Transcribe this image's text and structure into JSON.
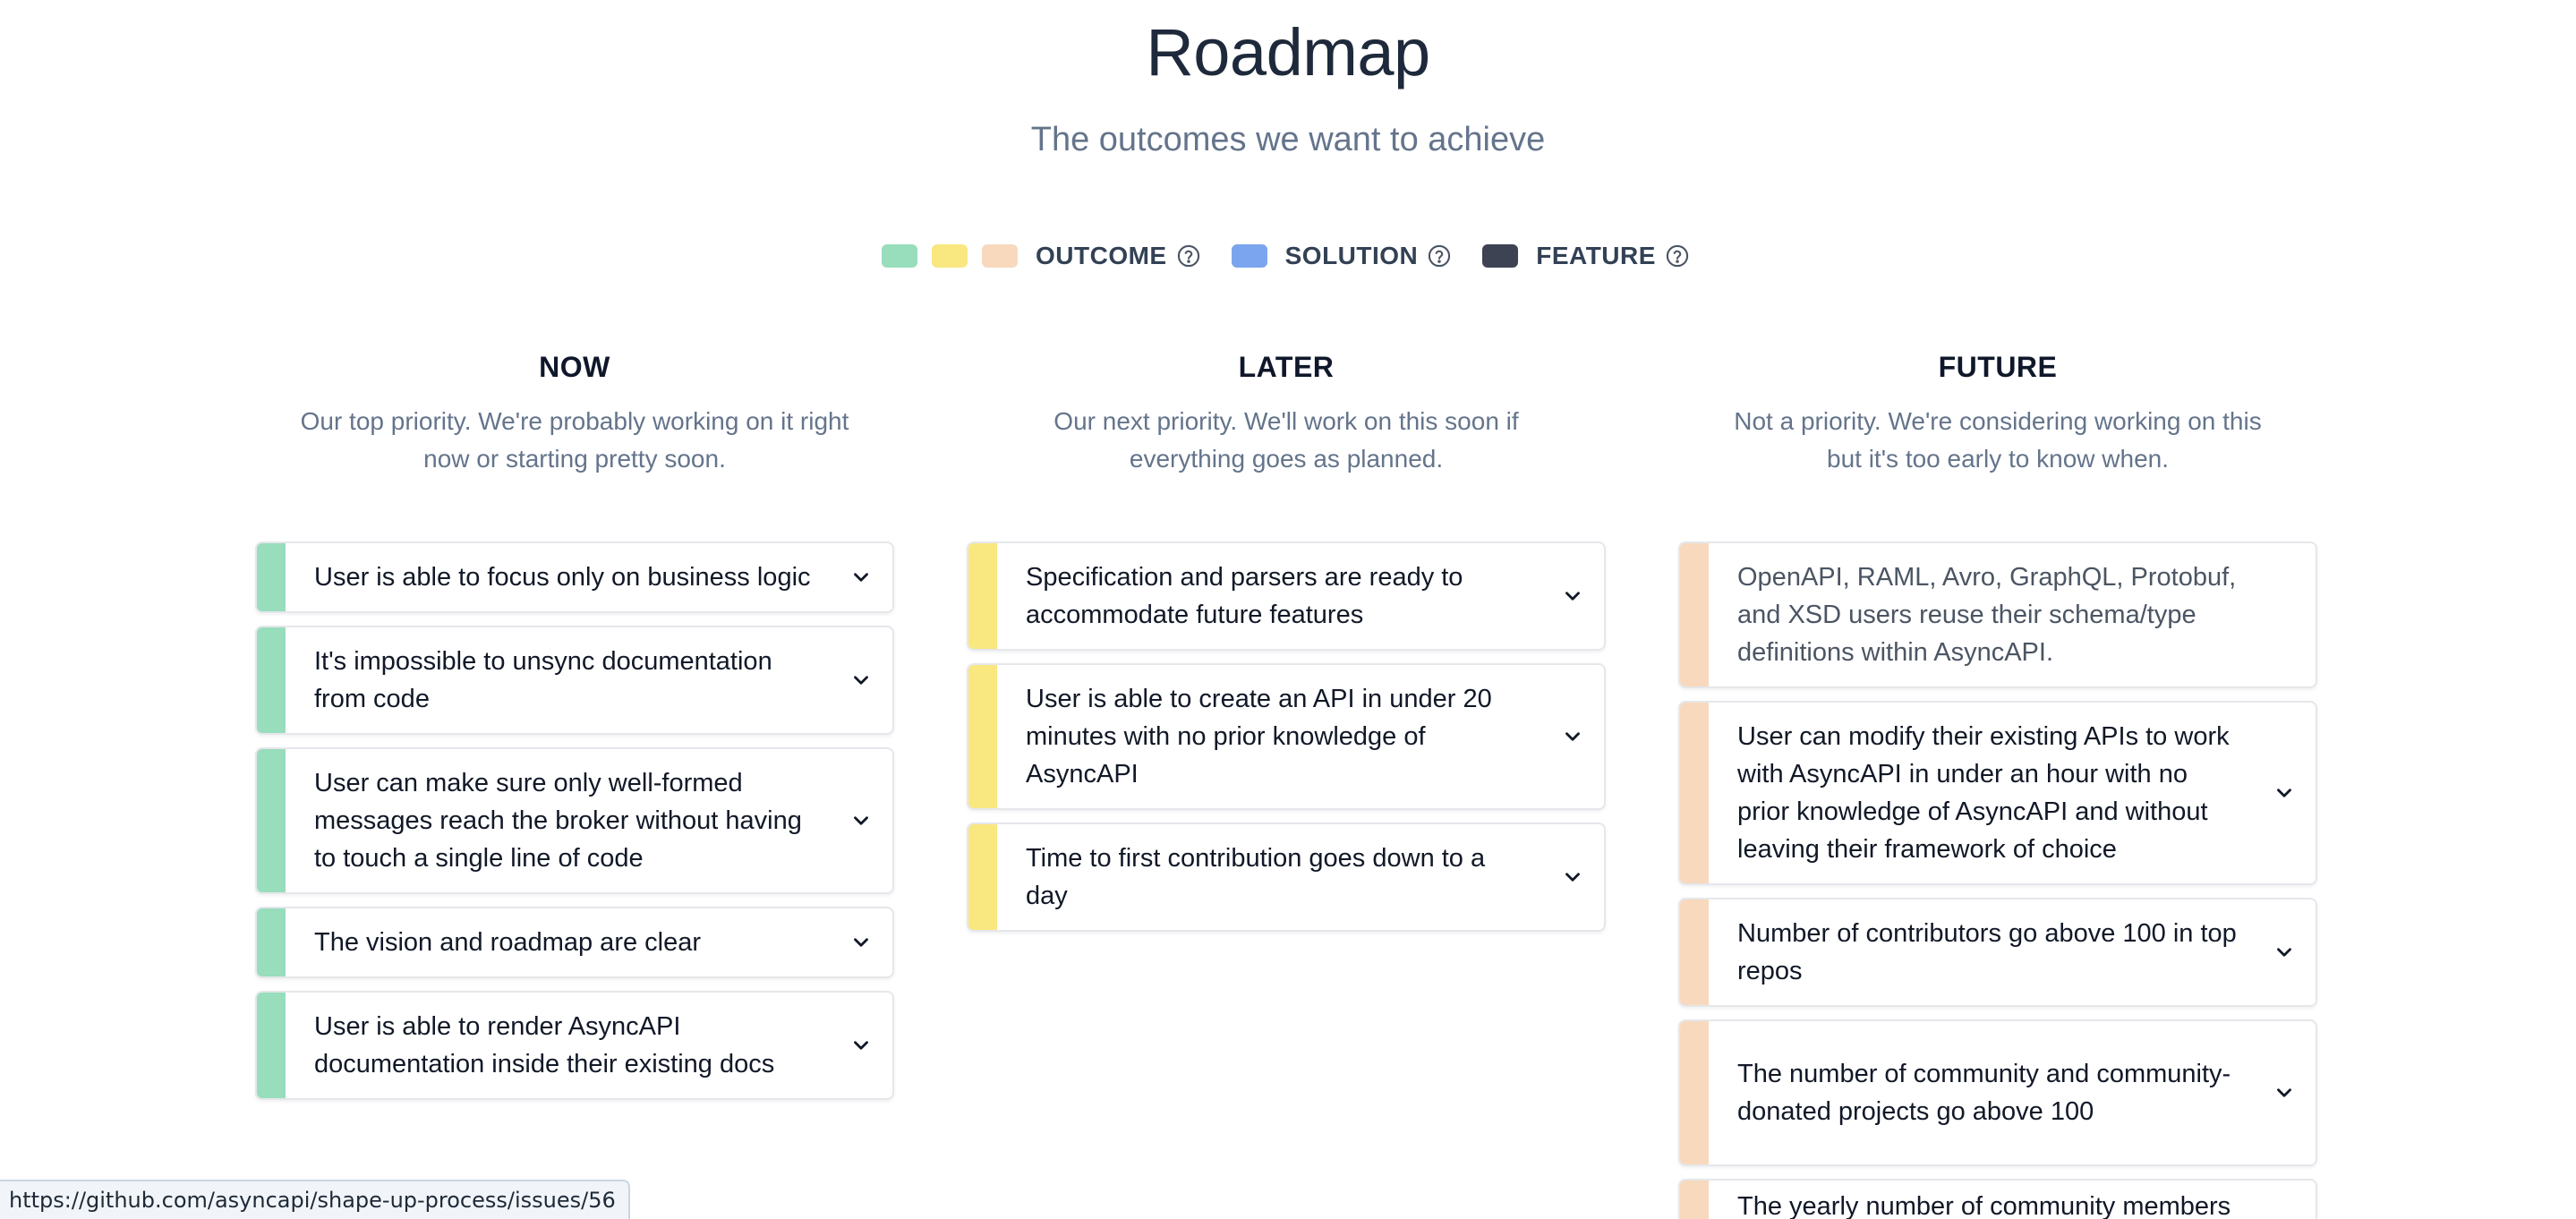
{
  "header": {
    "title": "Roadmap",
    "subtitle": "The outcomes we want to achieve"
  },
  "legend": {
    "outcome_label": "OUTCOME",
    "solution_label": "SOLUTION",
    "feature_label": "FEATURE",
    "colors": {
      "outcome_green": "#98ddbc",
      "outcome_yellow": "#f9e780",
      "outcome_peach": "#f8d9bd",
      "solution": "#7ca5ef",
      "feature": "#3d4352"
    }
  },
  "columns": {
    "now": {
      "heading": "NOW",
      "desc_line1": "Our top priority. We're probably working on it right",
      "desc_line2": "now or starting pretty soon.",
      "bar_color": "#98ddbc",
      "cards": [
        {
          "text": "User is able to focus only on business logic"
        },
        {
          "text": "It's impossible to unsync documentation from code"
        },
        {
          "text": "User can make sure only well-formed messages reach the broker without having to touch a single line of code"
        },
        {
          "text": "The vision and roadmap are clear"
        },
        {
          "text": "User is able to render AsyncAPI documentation inside their existing docs"
        }
      ]
    },
    "later": {
      "heading": "LATER",
      "desc_line1": "Our next priority. We'll work on this soon if",
      "desc_line2": "everything goes as planned.",
      "bar_color": "#f9e780",
      "cards": [
        {
          "text": "Specification and parsers are ready to accommodate future features"
        },
        {
          "text": "User is able to create an API in under 20 minutes with no prior knowledge of AsyncAPI"
        },
        {
          "text": "Time to first contribution goes down to a day"
        }
      ]
    },
    "future": {
      "heading": "FUTURE",
      "desc_line1": "Not a priority. We're considering working on this",
      "desc_line2": "but it's too early to know when.",
      "bar_color": "#f8d9bd",
      "cards": [
        {
          "text": "OpenAPI, RAML, Avro, GraphQL, Protobuf, and XSD users reuse their schema/type definitions within AsyncAPI."
        },
        {
          "text": "User can modify their existing APIs to work with AsyncAPI in under an hour with no prior knowledge of AsyncAPI and without leaving their framework of choice"
        },
        {
          "text": "Number of contributors go above 100 in top repos"
        },
        {
          "text": "The number of community and community-donated projects go above 100"
        },
        {
          "text": "The yearly number of community members"
        }
      ]
    }
  },
  "status_bar": {
    "url": "https://github.com/asyncapi/shape-up-process/issues/56"
  }
}
